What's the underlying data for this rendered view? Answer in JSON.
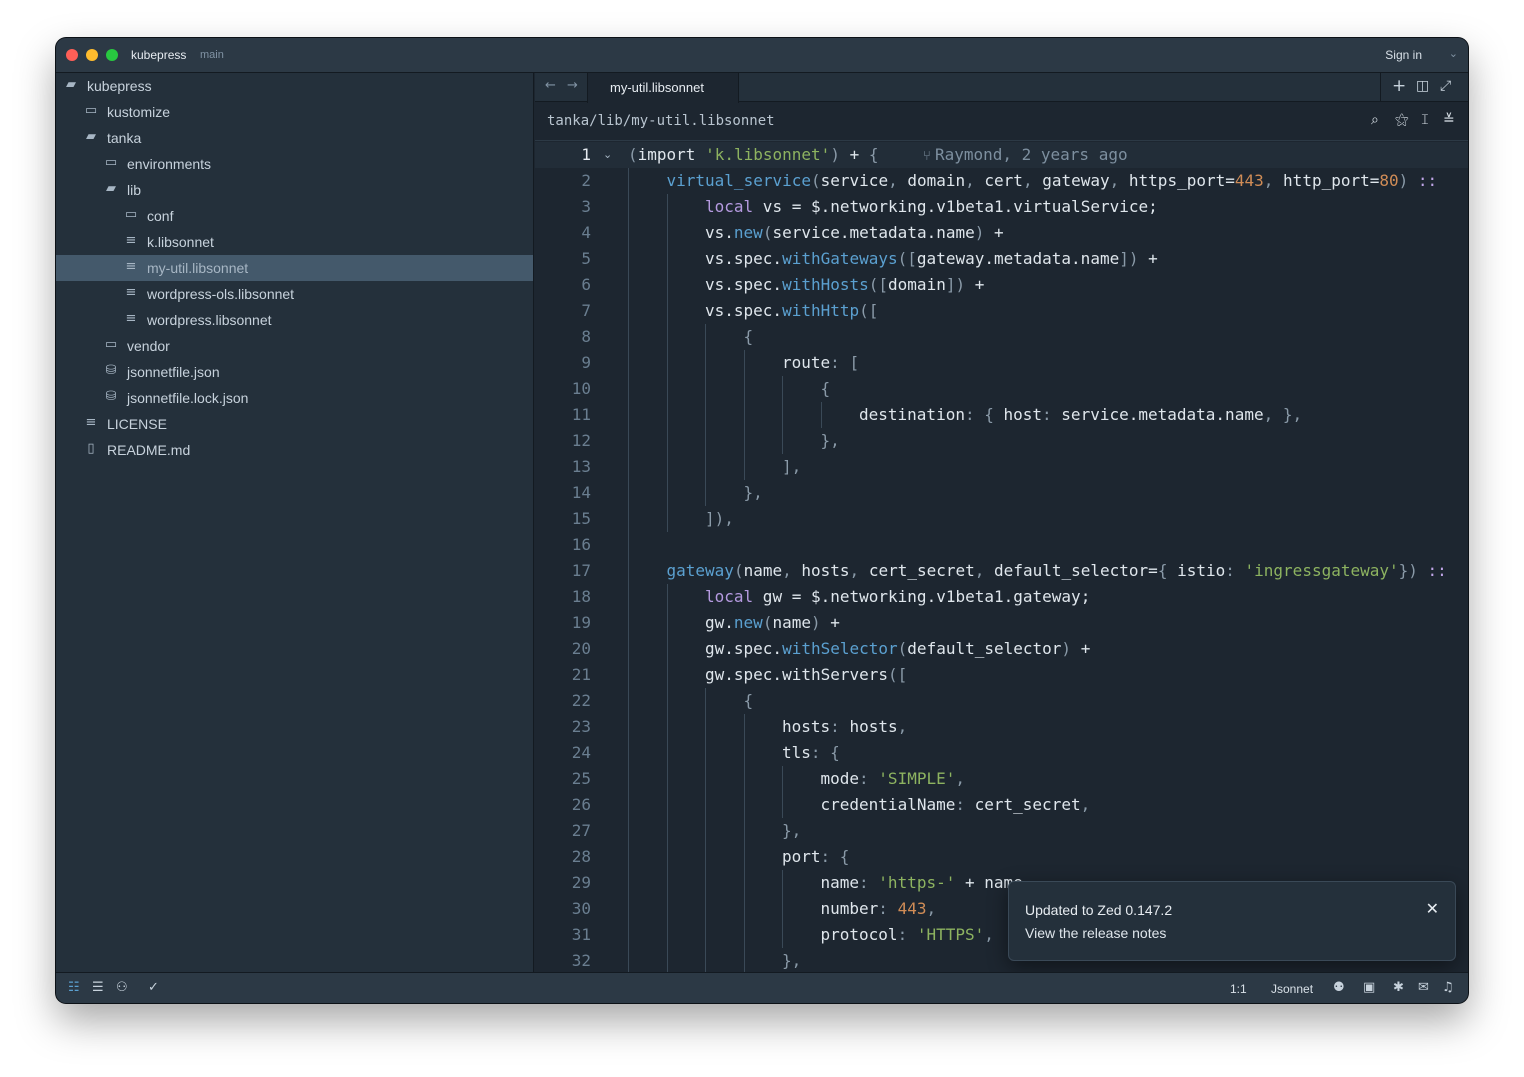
{
  "titlebar": {
    "project": "kubepress",
    "branch": "main",
    "sign_in": "Sign in",
    "chevron_icon": "chevron-down-icon"
  },
  "sidebar": {
    "items": [
      {
        "label": "kubepress",
        "icon": "folder-open-icon",
        "depth": 0
      },
      {
        "label": "kustomize",
        "icon": "folder-icon",
        "depth": 1
      },
      {
        "label": "tanka",
        "icon": "folder-open-icon",
        "depth": 1
      },
      {
        "label": "environments",
        "icon": "folder-icon",
        "depth": 2
      },
      {
        "label": "lib",
        "icon": "folder-open-icon",
        "depth": 2
      },
      {
        "label": "conf",
        "icon": "folder-icon",
        "depth": 3
      },
      {
        "label": "k.libsonnet",
        "icon": "file-text-icon",
        "depth": 3
      },
      {
        "label": "my-util.libsonnet",
        "icon": "file-text-icon",
        "depth": 3,
        "selected": true
      },
      {
        "label": "wordpress-ols.libsonnet",
        "icon": "file-text-icon",
        "depth": 3
      },
      {
        "label": "wordpress.libsonnet",
        "icon": "file-text-icon",
        "depth": 3
      },
      {
        "label": "vendor",
        "icon": "folder-icon",
        "depth": 2
      },
      {
        "label": "jsonnetfile.json",
        "icon": "database-icon",
        "depth": 2
      },
      {
        "label": "jsonnetfile.lock.json",
        "icon": "database-icon",
        "depth": 2
      },
      {
        "label": "LICENSE",
        "icon": "file-text-icon",
        "depth": 1
      },
      {
        "label": "README.md",
        "icon": "book-icon",
        "depth": 1
      }
    ]
  },
  "editor": {
    "tab_label": "my-util.libsonnet",
    "breadcrumb": "tanka/lib/my-util.libsonnet",
    "blame": "Raymond, 2 years ago",
    "lines": [
      {
        "n": 1,
        "indent": 0,
        "guides": 0,
        "tokens": [
          [
            "(",
            "p"
          ],
          [
            "import",
            ""
          ],
          [
            " ",
            ""
          ],
          [
            "'k.libsonnet'",
            "s"
          ],
          [
            ")",
            "p"
          ],
          [
            " + ",
            ""
          ],
          [
            "{",
            "p"
          ]
        ]
      },
      {
        "n": 2,
        "indent": 1,
        "guides": 1,
        "tokens": [
          [
            "virtual_service",
            "f"
          ],
          [
            "(",
            "p"
          ],
          [
            "service",
            ""
          ],
          [
            ", ",
            "p"
          ],
          [
            "domain",
            ""
          ],
          [
            ", ",
            "p"
          ],
          [
            "cert",
            ""
          ],
          [
            ", ",
            "p"
          ],
          [
            "gateway",
            ""
          ],
          [
            ", ",
            "p"
          ],
          [
            "https_port=",
            ""
          ],
          [
            "443",
            "n"
          ],
          [
            ", ",
            "p"
          ],
          [
            "http_port=",
            ""
          ],
          [
            "80",
            "n"
          ],
          [
            ")",
            "p"
          ],
          [
            " ::",
            "o"
          ]
        ]
      },
      {
        "n": 3,
        "indent": 2,
        "guides": 2,
        "tokens": [
          [
            "local",
            "k"
          ],
          [
            " vs = $.networking.v1beta1.virtualService;",
            ""
          ]
        ]
      },
      {
        "n": 4,
        "indent": 2,
        "guides": 2,
        "tokens": [
          [
            "vs.",
            ""
          ],
          [
            "new",
            "f"
          ],
          [
            "(",
            "p"
          ],
          [
            "service.metadata.name",
            ""
          ],
          [
            ")",
            "p"
          ],
          [
            " +",
            ""
          ]
        ]
      },
      {
        "n": 5,
        "indent": 2,
        "guides": 2,
        "tokens": [
          [
            "vs.spec.",
            ""
          ],
          [
            "withGateways",
            "f"
          ],
          [
            "([",
            "p"
          ],
          [
            "gateway.metadata.name",
            ""
          ],
          [
            "])",
            "p"
          ],
          [
            " +",
            ""
          ]
        ]
      },
      {
        "n": 6,
        "indent": 2,
        "guides": 2,
        "tokens": [
          [
            "vs.spec.",
            ""
          ],
          [
            "withHosts",
            "f"
          ],
          [
            "([",
            "p"
          ],
          [
            "domain",
            ""
          ],
          [
            "])",
            "p"
          ],
          [
            " +",
            ""
          ]
        ]
      },
      {
        "n": 7,
        "indent": 2,
        "guides": 2,
        "tokens": [
          [
            "vs.spec.",
            ""
          ],
          [
            "withHttp",
            "f"
          ],
          [
            "([",
            "p"
          ]
        ]
      },
      {
        "n": 8,
        "indent": 3,
        "guides": 3,
        "tokens": [
          [
            "{",
            "p"
          ]
        ]
      },
      {
        "n": 9,
        "indent": 4,
        "guides": 4,
        "tokens": [
          [
            "route",
            ""
          ],
          [
            ": [",
            "p"
          ]
        ]
      },
      {
        "n": 10,
        "indent": 5,
        "guides": 5,
        "tokens": [
          [
            "{",
            "p"
          ]
        ]
      },
      {
        "n": 11,
        "indent": 6,
        "guides": 6,
        "tokens": [
          [
            "destination",
            ""
          ],
          [
            ": { ",
            "p"
          ],
          [
            "host",
            ""
          ],
          [
            ": ",
            "p"
          ],
          [
            "service.metadata.name",
            ""
          ],
          [
            ", },",
            "p"
          ]
        ]
      },
      {
        "n": 12,
        "indent": 5,
        "guides": 5,
        "tokens": [
          [
            "},",
            "p"
          ]
        ]
      },
      {
        "n": 13,
        "indent": 4,
        "guides": 4,
        "tokens": [
          [
            "],",
            "p"
          ]
        ]
      },
      {
        "n": 14,
        "indent": 3,
        "guides": 3,
        "tokens": [
          [
            "},",
            "p"
          ]
        ]
      },
      {
        "n": 15,
        "indent": 2,
        "guides": 2,
        "tokens": [
          [
            "]),",
            "p"
          ]
        ]
      },
      {
        "n": 16,
        "indent": 0,
        "guides": 1,
        "tokens": []
      },
      {
        "n": 17,
        "indent": 1,
        "guides": 1,
        "tokens": [
          [
            "gateway",
            "f"
          ],
          [
            "(",
            "p"
          ],
          [
            "name",
            ""
          ],
          [
            ", ",
            "p"
          ],
          [
            "hosts",
            ""
          ],
          [
            ", ",
            "p"
          ],
          [
            "cert_secret",
            ""
          ],
          [
            ", ",
            "p"
          ],
          [
            "default_selector=",
            ""
          ],
          [
            "{ ",
            "p"
          ],
          [
            "istio",
            ""
          ],
          [
            ": ",
            "p"
          ],
          [
            "'ingressgateway'",
            "s"
          ],
          [
            "})",
            "p"
          ],
          [
            " ::",
            "o"
          ]
        ]
      },
      {
        "n": 18,
        "indent": 2,
        "guides": 2,
        "tokens": [
          [
            "local",
            "k"
          ],
          [
            " gw = $.networking.v1beta1.gateway;",
            ""
          ]
        ]
      },
      {
        "n": 19,
        "indent": 2,
        "guides": 2,
        "tokens": [
          [
            "gw.",
            ""
          ],
          [
            "new",
            "f"
          ],
          [
            "(",
            "p"
          ],
          [
            "name",
            ""
          ],
          [
            ")",
            "p"
          ],
          [
            " +",
            ""
          ]
        ]
      },
      {
        "n": 20,
        "indent": 2,
        "guides": 2,
        "tokens": [
          [
            "gw.spec.",
            ""
          ],
          [
            "withSelector",
            "f"
          ],
          [
            "(",
            "p"
          ],
          [
            "default_selector",
            ""
          ],
          [
            ")",
            "p"
          ],
          [
            " +",
            ""
          ]
        ]
      },
      {
        "n": 21,
        "indent": 2,
        "guides": 2,
        "tokens": [
          [
            "gw.spec.withServers",
            ""
          ],
          [
            "([",
            "p"
          ]
        ]
      },
      {
        "n": 22,
        "indent": 3,
        "guides": 3,
        "tokens": [
          [
            "{",
            "p"
          ]
        ]
      },
      {
        "n": 23,
        "indent": 4,
        "guides": 4,
        "tokens": [
          [
            "hosts",
            ""
          ],
          [
            ": ",
            "p"
          ],
          [
            "hosts",
            ""
          ],
          [
            ",",
            "p"
          ]
        ]
      },
      {
        "n": 24,
        "indent": 4,
        "guides": 4,
        "tokens": [
          [
            "tls",
            ""
          ],
          [
            ": {",
            "p"
          ]
        ]
      },
      {
        "n": 25,
        "indent": 5,
        "guides": 5,
        "tokens": [
          [
            "mode",
            ""
          ],
          [
            ": ",
            "p"
          ],
          [
            "'SIMPLE'",
            "s"
          ],
          [
            ",",
            "p"
          ]
        ]
      },
      {
        "n": 26,
        "indent": 5,
        "guides": 5,
        "tokens": [
          [
            "credentialName",
            ""
          ],
          [
            ": ",
            "p"
          ],
          [
            "cert_secret",
            ""
          ],
          [
            ",",
            "p"
          ]
        ]
      },
      {
        "n": 27,
        "indent": 4,
        "guides": 4,
        "tokens": [
          [
            "},",
            "p"
          ]
        ]
      },
      {
        "n": 28,
        "indent": 4,
        "guides": 4,
        "tokens": [
          [
            "port",
            ""
          ],
          [
            ": {",
            "p"
          ]
        ]
      },
      {
        "n": 29,
        "indent": 5,
        "guides": 5,
        "tokens": [
          [
            "name",
            ""
          ],
          [
            ": ",
            "p"
          ],
          [
            "'https-'",
            "s"
          ],
          [
            " + name",
            ""
          ]
        ]
      },
      {
        "n": 30,
        "indent": 5,
        "guides": 5,
        "tokens": [
          [
            "number",
            ""
          ],
          [
            ": ",
            "p"
          ],
          [
            "443",
            "n"
          ],
          [
            ",",
            "p"
          ]
        ]
      },
      {
        "n": 31,
        "indent": 5,
        "guides": 5,
        "tokens": [
          [
            "protocol",
            ""
          ],
          [
            ": ",
            "p"
          ],
          [
            "'HTTPS'",
            "s"
          ],
          [
            ",",
            "p"
          ]
        ]
      },
      {
        "n": 32,
        "indent": 4,
        "guides": 4,
        "tokens": [
          [
            "},",
            "p"
          ]
        ]
      }
    ]
  },
  "toast": {
    "title": "Updated to Zed 0.147.2",
    "link": "View the release notes"
  },
  "statusbar": {
    "cursor_position": "1:1",
    "language": "Jsonnet"
  },
  "colors": {
    "background": "#1d2630",
    "string": "#8db360",
    "number": "#d08c56",
    "function": "#5ba0d0",
    "keyword": "#b59ae0"
  }
}
